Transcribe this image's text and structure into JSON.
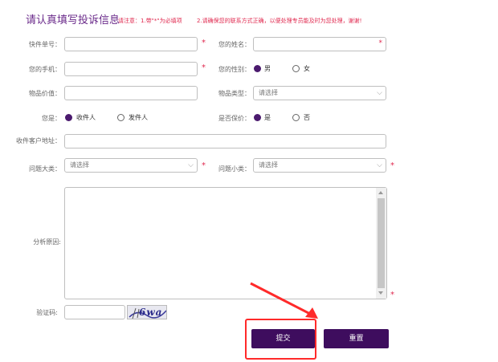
{
  "header": {
    "title": "请认真填写投诉信息",
    "note1": "请注意：1.带\"*\"为必填项",
    "note2": "2.请确保您的联系方式正确，以便处理专员能及时为您处理，谢谢!"
  },
  "form": {
    "tracking_label": "快件单号：",
    "name_label": "您的姓名：",
    "phone_label": "您的手机：",
    "gender_label": "您的性别：",
    "gender_options": [
      "男",
      "女"
    ],
    "value_label": "物品价值：",
    "item_type_label": "物品类型：",
    "item_type_value": "请选择",
    "role_label": "您是：",
    "role_options": [
      "收件人",
      "发件人"
    ],
    "insured_label": "是否保价：",
    "insured_options": [
      "是",
      "否"
    ],
    "address_label": "收件客户地址：",
    "category_label": "问题大类：",
    "category_value": "请选择",
    "subcategory_label": "问题小类：",
    "subcategory_value": "请选择",
    "reason_label": "分析原因:",
    "captcha_label": "验证码:",
    "captcha_text": "6wa",
    "required_mark": "*"
  },
  "buttons": {
    "submit": "提交",
    "reset": "重置"
  },
  "colors": {
    "primary": "#3e0d5e",
    "required": "#e0294f",
    "annotation": "#ff2a2a"
  },
  "icons": {
    "chevron": "chevron-down-icon",
    "annotation_arrow": "arrow-annotation"
  }
}
